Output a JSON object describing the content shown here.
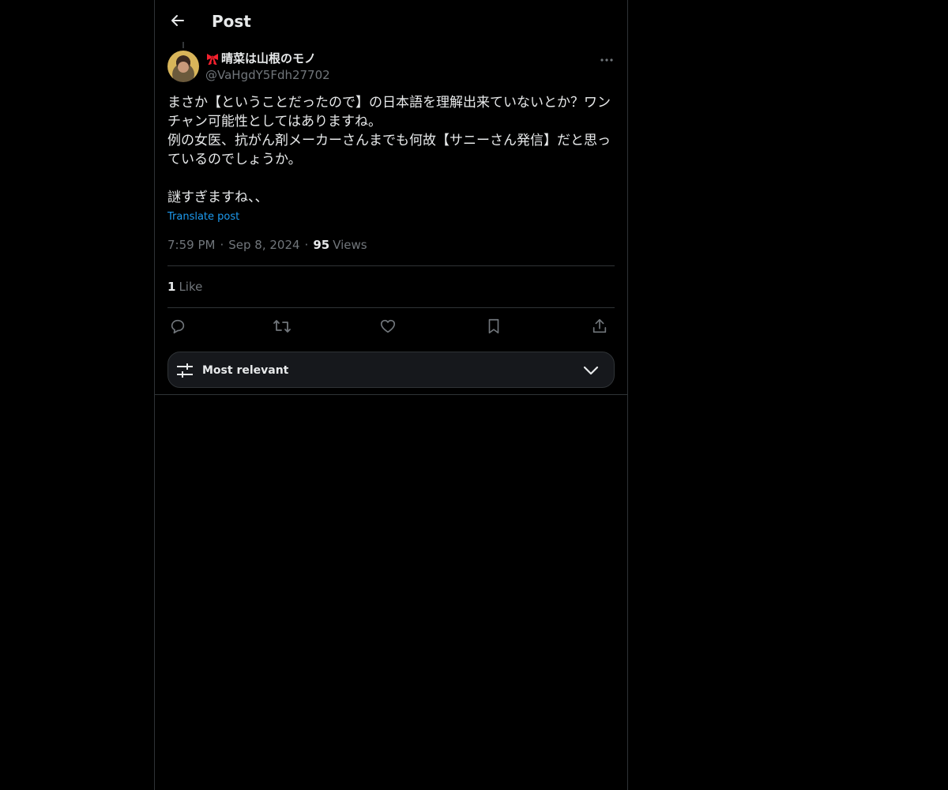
{
  "header": {
    "title": "Post",
    "back_icon": "arrow-left-icon"
  },
  "post": {
    "author": {
      "display_name": "晴菜は山根のモノ",
      "name_emoji": "ribbon-icon",
      "handle": "@VaHgdY5Fdh27702"
    },
    "text": "まさか【ということだったので】の日本語を理解出来ていないとか？ワンチャン可能性としてはありますね。\n例の女医、抗がん剤メーカーさんまでも何故【サニーさん発信】だと思っているのでしょうか。\n\n謎すぎますね、、",
    "translate_label": "Translate post",
    "time": "7:59 PM",
    "date": "Sep 8, 2024",
    "separator": "·",
    "views_count": "95",
    "views_label": "Views",
    "likes_count": "1",
    "likes_label": "Like"
  },
  "actions": {
    "icons": [
      "reply-icon",
      "repost-icon",
      "like-icon",
      "bookmark-icon",
      "share-icon"
    ]
  },
  "sort": {
    "label": "Most relevant",
    "icon": "sliders-icon",
    "chevron": "chevron-down-icon"
  },
  "colors": {
    "background": "#000000",
    "text": "#e7e9ea",
    "secondary": "#71767b",
    "link": "#1d9bf0",
    "border": "#2f3336",
    "sort_bg": "#16181c",
    "ribbon": "#f4212e"
  }
}
